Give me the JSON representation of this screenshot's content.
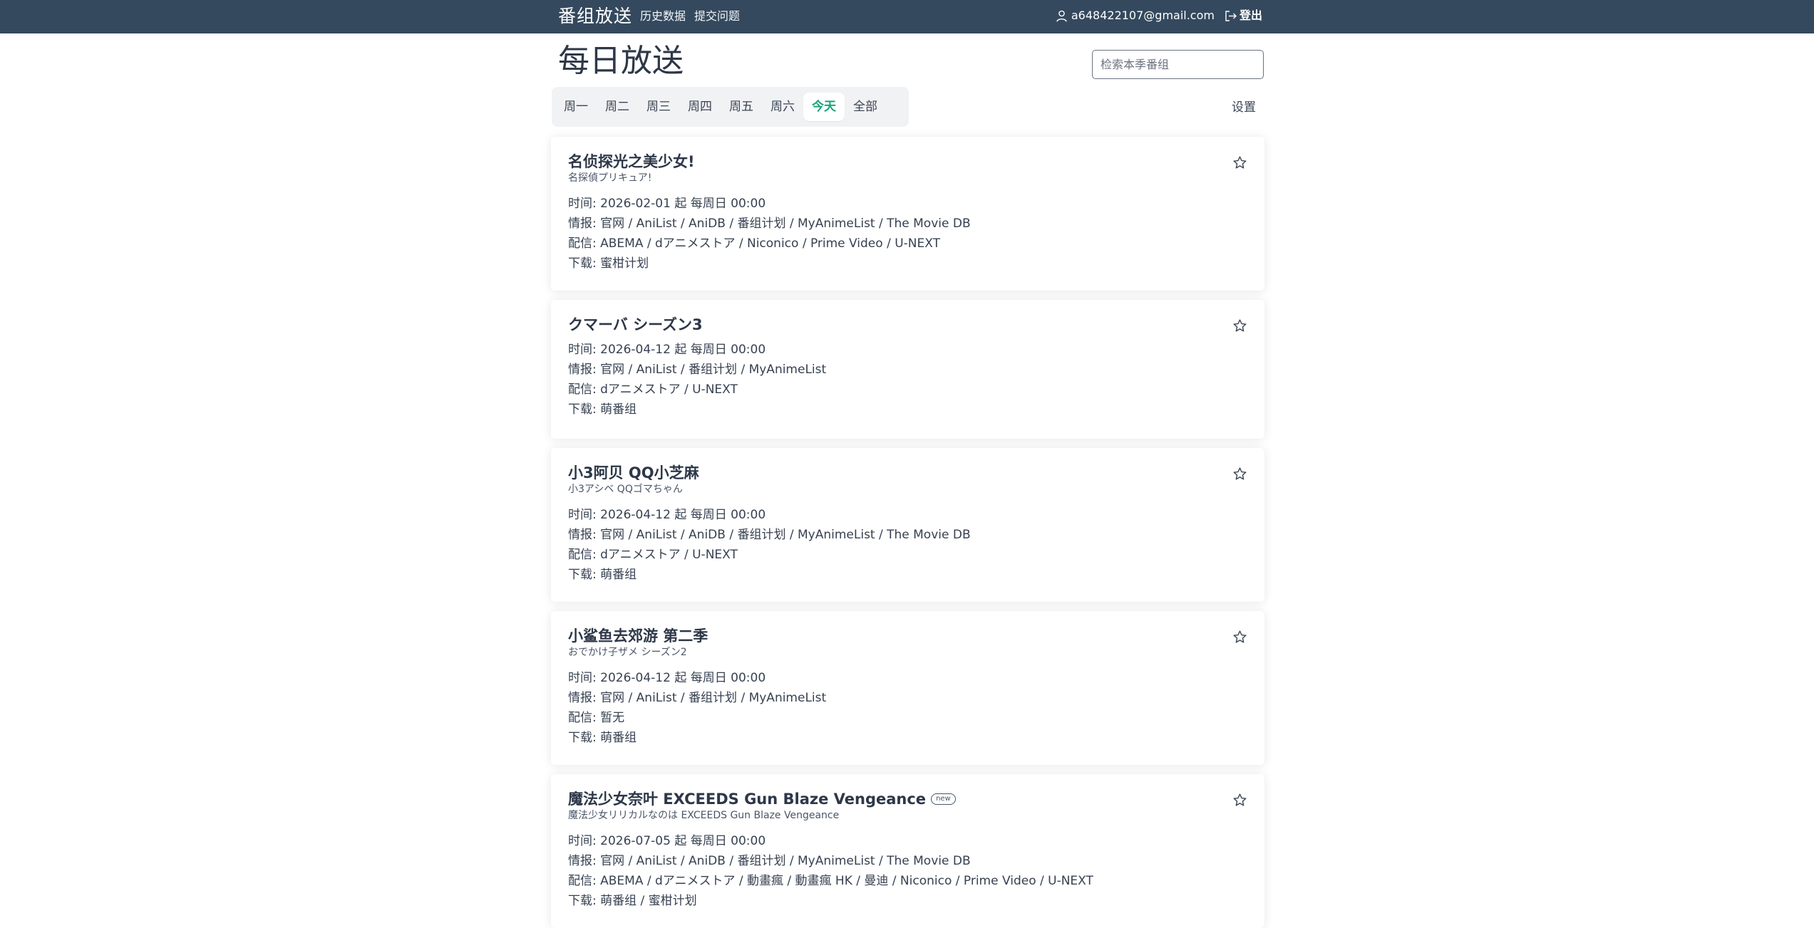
{
  "navbar": {
    "brand": "番组放送",
    "links": [
      "历史数据",
      "提交问题"
    ],
    "user_email": "a648422107@gmail.com",
    "logout_label": "登出"
  },
  "header": {
    "title": "每日放送",
    "search_placeholder": "检索本季番组",
    "settings_label": "设置"
  },
  "day_tabs": [
    {
      "label": "周一",
      "active": false
    },
    {
      "label": "周二",
      "active": false
    },
    {
      "label": "周三",
      "active": false
    },
    {
      "label": "周四",
      "active": false
    },
    {
      "label": "周五",
      "active": false
    },
    {
      "label": "周六",
      "active": false
    },
    {
      "label": "今天",
      "active": true
    },
    {
      "label": "全部",
      "active": false
    }
  ],
  "colors": {
    "navbar_bg": "#34495e",
    "active_tab": "#1aa37a",
    "tab_bar_bg": "#f1f2f4"
  },
  "cards": [
    {
      "title": "名侦探光之美少女!",
      "subtitle": "名探偵プリキュア!",
      "is_new": false,
      "time": "时间: 2026-02-01 起 每周日 00:00",
      "info": "情报: 官网 / AniList / AniDB / 番组计划 / MyAnimeList / The Movie DB",
      "streaming": "配信: ABEMA / dアニメストア / Niconico / Prime Video / U-NEXT",
      "download": "下载: 蜜柑计划"
    },
    {
      "title": "クマーバ シーズン3",
      "subtitle": "",
      "is_new": false,
      "time": "时间: 2026-04-12 起 每周日 00:00",
      "info": "情报: 官网 / AniList / 番组计划 / MyAnimeList",
      "streaming": "配信: dアニメストア / U-NEXT",
      "download": "下载: 萌番组"
    },
    {
      "title": "小3阿贝 QQ小芝麻",
      "subtitle": "小3アシベ QQゴマちゃん",
      "is_new": false,
      "time": "时间: 2026-04-12 起 每周日 00:00",
      "info": "情报: 官网 / AniList / AniDB / 番组计划 / MyAnimeList / The Movie DB",
      "streaming": "配信: dアニメストア / U-NEXT",
      "download": "下载: 萌番组"
    },
    {
      "title": "小鲨鱼去郊游 第二季",
      "subtitle": "おでかけ子ザメ シーズン2",
      "is_new": false,
      "time": "时间: 2026-04-12 起 每周日 00:00",
      "info": "情报: 官网 / AniList / 番组计划 / MyAnimeList",
      "streaming": "配信: 暂无",
      "download": "下载: 萌番组"
    },
    {
      "title": "魔法少女奈叶 EXCEEDS Gun Blaze Vengeance",
      "subtitle": "魔法少女リリカルなのは EXCEEDS Gun Blaze Vengeance",
      "is_new": true,
      "new_label": "new",
      "time": "时间: 2026-07-05 起 每周日 00:00",
      "info": "情报: 官网 / AniList / AniDB / 番组计划 / MyAnimeList / The Movie DB",
      "streaming": "配信: ABEMA / dアニメストア / 動畫瘋 / 動畫瘋 HK / 曼迪 / Niconico / Prime Video / U-NEXT",
      "download": "下载: 萌番组 / 蜜柑计划"
    }
  ]
}
